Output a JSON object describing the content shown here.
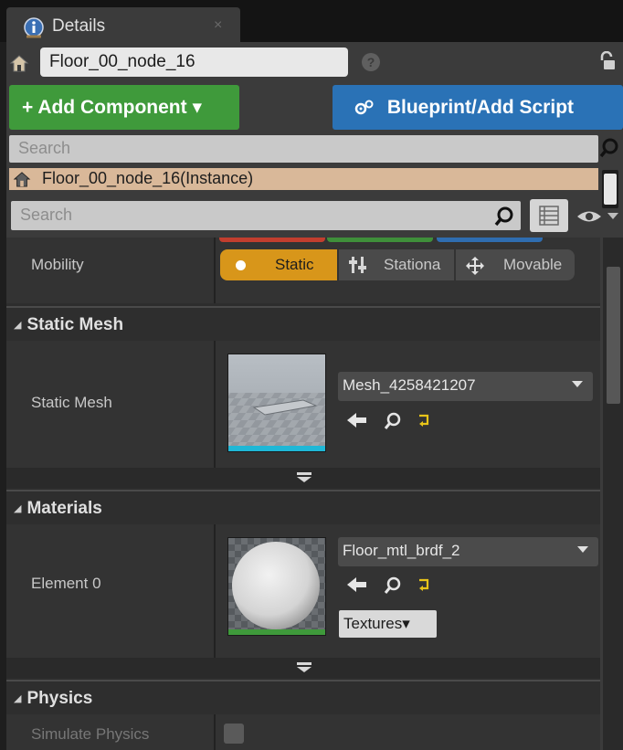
{
  "tab": {
    "title": "Details",
    "close": "×"
  },
  "actor": {
    "name": "Floor_00_node_16",
    "help": "?"
  },
  "toolbar": {
    "add_component": "+ Add Component",
    "add_component_arrow": "▾",
    "blueprint": "Blueprint/Add Script"
  },
  "component_search": {
    "placeholder": "Search"
  },
  "component_tree": {
    "instance_label": "Floor_00_node_16(Instance)"
  },
  "details_search": {
    "placeholder": "Search"
  },
  "mobility": {
    "label": "Mobility",
    "options": [
      "Static",
      "Stationa",
      "Movable"
    ],
    "selected": "Static"
  },
  "sections": {
    "static_mesh": {
      "title": "Static Mesh",
      "row_label": "Static Mesh",
      "asset": "Mesh_4258421207",
      "thumb_bar_color": "#1fb7d6"
    },
    "materials": {
      "title": "Materials",
      "row_label": "Element 0",
      "asset": "Floor_mtl_brdf_2",
      "textures_button": "Textures",
      "textures_arrow": "▾",
      "thumb_bar_color": "#3f9a3b"
    },
    "physics": {
      "title": "Physics",
      "simulate_label": "Simulate Physics"
    }
  },
  "colors": {
    "add_component": "#3f9a3b",
    "blueprint": "#2a72b6",
    "static_selected": "#d8961a",
    "instance_row": "#d9b899"
  }
}
